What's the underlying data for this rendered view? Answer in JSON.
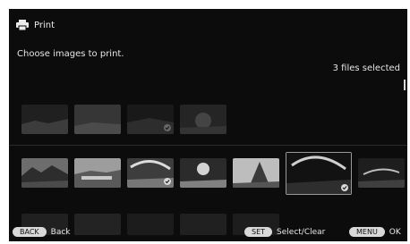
{
  "header": {
    "title": "Print",
    "icon": "printer-icon"
  },
  "instructions": "Choose images to print.",
  "status": {
    "selected_text": "3 files selected"
  },
  "thumbnails": {
    "top_row": [
      "image-1",
      "image-2",
      "image-3",
      "image-4"
    ],
    "middle_row": [
      "image-5",
      "image-6",
      "image-7",
      "image-8",
      "image-9",
      "image-10",
      "image-11"
    ],
    "bottom_row": [
      "image-12",
      "image-13",
      "image-14",
      "image-15",
      "image-16"
    ]
  },
  "footer": {
    "back_key": "BACK",
    "back_label": "Back",
    "set_key": "SET",
    "set_label": "Select/Clear",
    "menu_key": "MENU",
    "menu_label": "OK"
  },
  "colors": {
    "background": "#0c0c0c",
    "text": "#eaeaea",
    "pill": "#d9d9d9"
  }
}
